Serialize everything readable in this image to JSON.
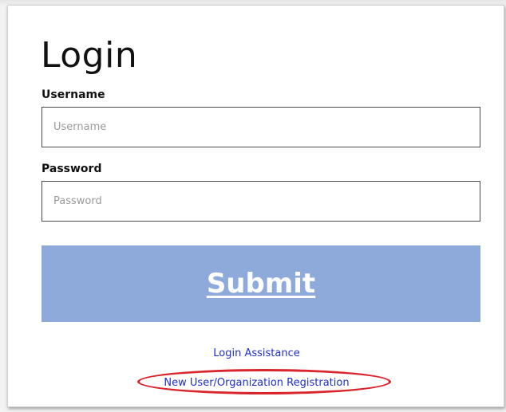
{
  "login": {
    "title": "Login",
    "username_label": "Username",
    "username_placeholder": "Username",
    "username_value": "",
    "password_label": "Password",
    "password_placeholder": "Password",
    "password_value": "",
    "submit_label": "Submit",
    "links": {
      "assistance": "Login Assistance",
      "registration": "New User/Organization Registration"
    }
  },
  "colors": {
    "submit_background": "#8eaadb",
    "link": "#1f2fc9",
    "highlight_ring": "#d9252b"
  }
}
